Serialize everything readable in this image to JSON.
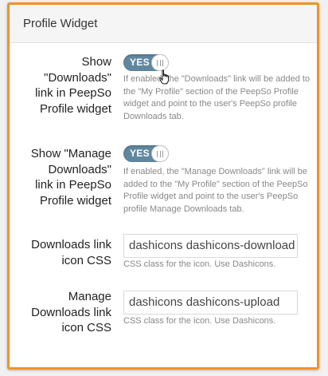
{
  "panel": {
    "title": "Profile Widget"
  },
  "fields": [
    {
      "label_lines": [
        "Show",
        "\"Downloads\"",
        "link in PeepSo",
        "Profile widget"
      ],
      "toggle": "YES",
      "help_lines": [
        "If enabled, the \"Downloads\" link will be added to",
        "the \"My Profile\" section of the PeepSo Profile",
        "widget and point to the user's PeepSo profile",
        "Downloads tab."
      ]
    },
    {
      "label_lines": [
        "Show \"Manage",
        "Downloads\"",
        "link in PeepSo",
        "Profile widget"
      ],
      "toggle": "YES",
      "help_lines": [
        "If enabled, the \"Manage Downloads\" link will be",
        "added to the \"My Profile\" section of the PeepSo",
        "Profile widget and point to the user's PeepSo",
        "profile Manage Downloads tab."
      ]
    },
    {
      "label_lines": [
        "Downloads link",
        "icon CSS"
      ],
      "value": "dashicons dashicons-download",
      "help": "CSS class for the icon. Use Dashicons."
    },
    {
      "label_lines": [
        "Manage",
        "Downloads link",
        "icon CSS"
      ],
      "value": "dashicons dashicons-upload",
      "help": "CSS class for the icon. Use Dashicons."
    }
  ],
  "colors": {
    "accent_border": "#f0922b",
    "toggle_on": "#61879f"
  },
  "icons": {
    "cursor": "hand-pointer-icon"
  }
}
